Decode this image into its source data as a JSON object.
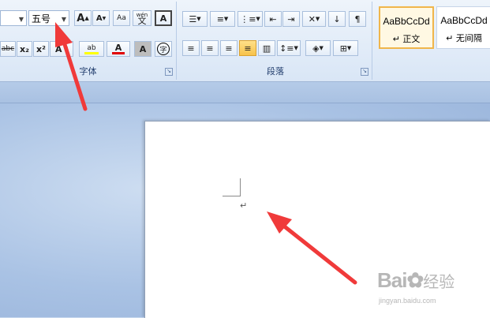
{
  "font_group": {
    "label": "字体",
    "font_size_value": "五号",
    "font_name_value": "",
    "buttons": {
      "grow_font": "A",
      "shrink_font": "A",
      "clear_format": "Aa",
      "phonetic": "wén",
      "phonetic_char": "文",
      "char_border": "A",
      "strikethrough": "abc",
      "subscript": "x₂",
      "superscript": "x²",
      "text_effect": "A",
      "highlight": "ab",
      "font_color": "A",
      "char_shading": "A",
      "enclose": "字"
    }
  },
  "paragraph_group": {
    "label": "段落"
  },
  "styles": [
    {
      "sample": "AaBbCcDd",
      "name": "↵ 正文",
      "active": true
    },
    {
      "sample": "AaBbCcDd",
      "name": "↵ 无间隔",
      "active": false
    }
  ],
  "document": {
    "paragraph_mark": "↵"
  },
  "watermark": {
    "brand": "Bai",
    "cn": "经验",
    "url": "jingyan.baidu.com"
  },
  "colors": {
    "highlight_bar": "#ffff00",
    "font_color_bar": "#e00000",
    "arrow": "#f03a3a",
    "active_style_border": "#f0b64b"
  }
}
